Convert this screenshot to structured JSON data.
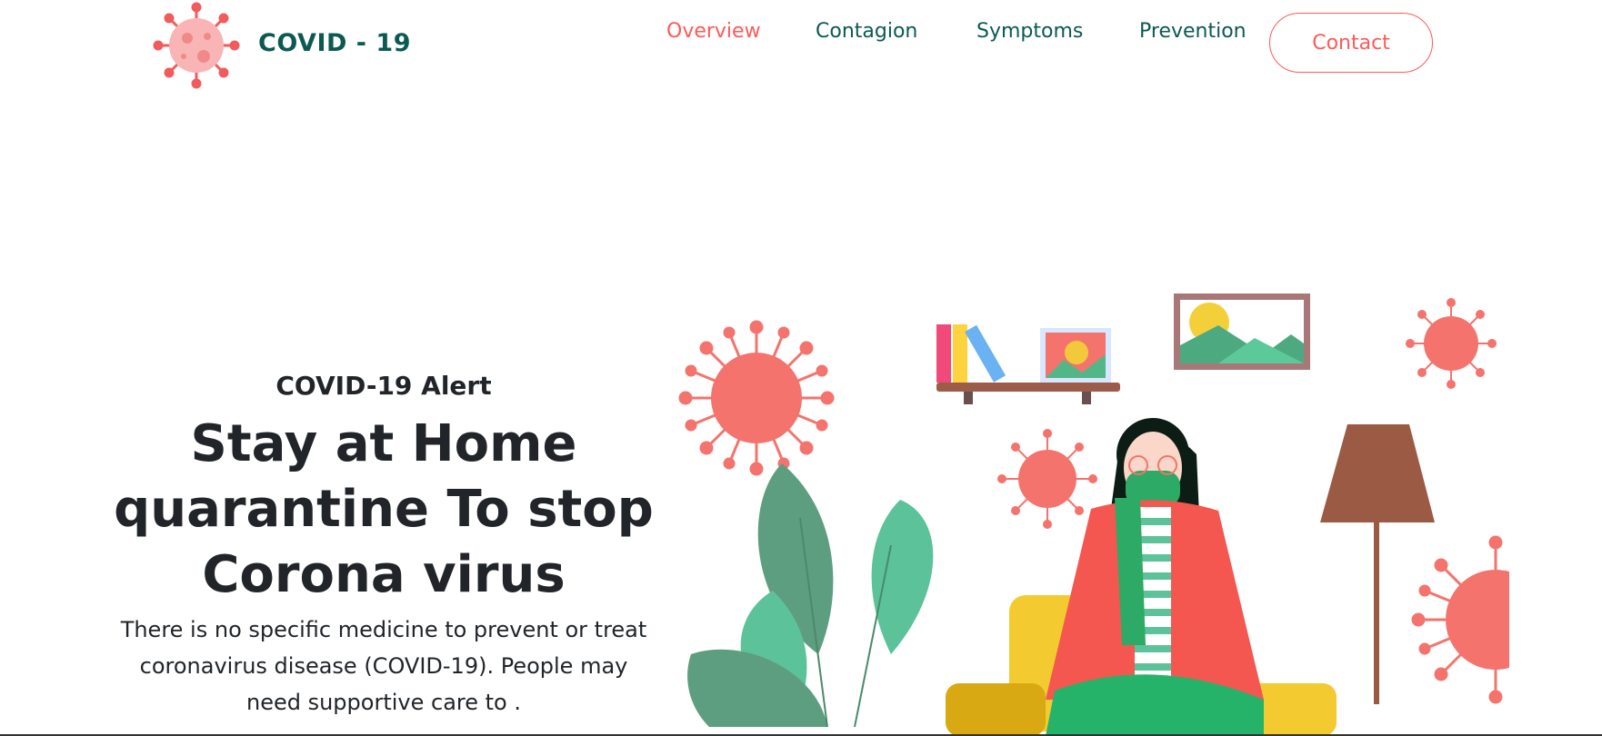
{
  "header": {
    "brand": "COVID - 19",
    "nav": [
      {
        "label": "Overview",
        "active": true
      },
      {
        "label": "Contagion",
        "active": false
      },
      {
        "label": "Symptoms",
        "active": false
      },
      {
        "label": "Prevention",
        "active": false
      }
    ],
    "contact_label": "Contact"
  },
  "hero": {
    "alert": "COVID-19 Alert",
    "headline": "Stay at Home quarantine To stop Corona virus",
    "description": "There is no specific medicine to prevent or treat coronavirus disease (COVID-19). People may need supportive care to ."
  },
  "colors": {
    "brand_green": "#0b5a52",
    "accent_red": "#ff5a57",
    "text_dark": "#212529"
  },
  "icons": {
    "logo": "virus-icon",
    "illustration": "woman-quarantine-illustration"
  }
}
